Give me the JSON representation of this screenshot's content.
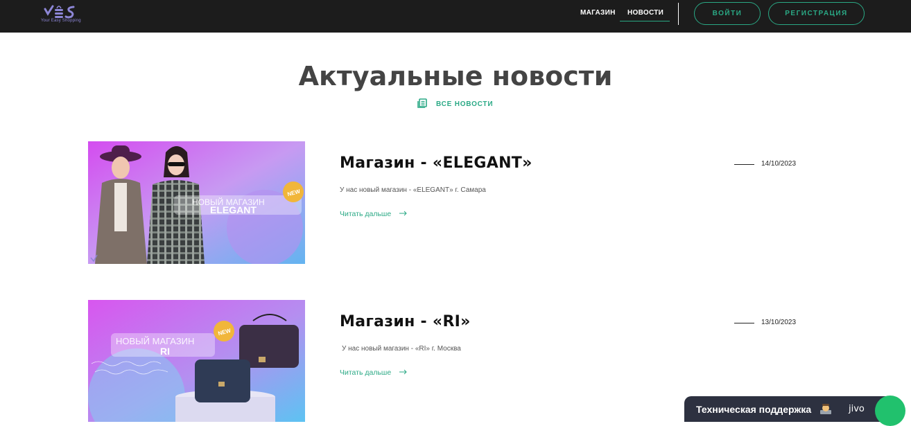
{
  "header": {
    "logo_sub": "Your Easy Shopping",
    "nav": {
      "shop": "МАГАЗИН",
      "news": "НОВОСТИ"
    },
    "login_label": "ВОЙТИ",
    "register_label": "РЕГИСТРАЦИЯ"
  },
  "page": {
    "title": "Актуальные новости",
    "all_news_label": "ВСЕ НОВОСТИ"
  },
  "news": [
    {
      "title": "Магазин - «ELEGANT»",
      "description": "У нас новый магазин - «ELEGANT» г. Самара",
      "read_more": "Читать дальше",
      "date": "14/10/2023",
      "image_text_line1": "НОВЫЙ МАГАЗИН",
      "image_text_line2": "ELEGANT",
      "badge": "NEW"
    },
    {
      "title": "Магазин - «RI»",
      "description": "У нас новый магазин - «RI» г. Москва",
      "read_more": "Читать дальше",
      "date": "13/10/2023",
      "image_text_line1": "НОВЫЙ МАГАЗИН",
      "image_text_line2": "RI",
      "badge": "NEW"
    }
  ],
  "chat": {
    "label": "Техническая поддержка",
    "brand": "jivo"
  },
  "colors": {
    "accent": "#2aa985",
    "header_bg": "#1c1c1c",
    "chat_bg": "#2d3140",
    "chat_accent": "#21c16d"
  }
}
